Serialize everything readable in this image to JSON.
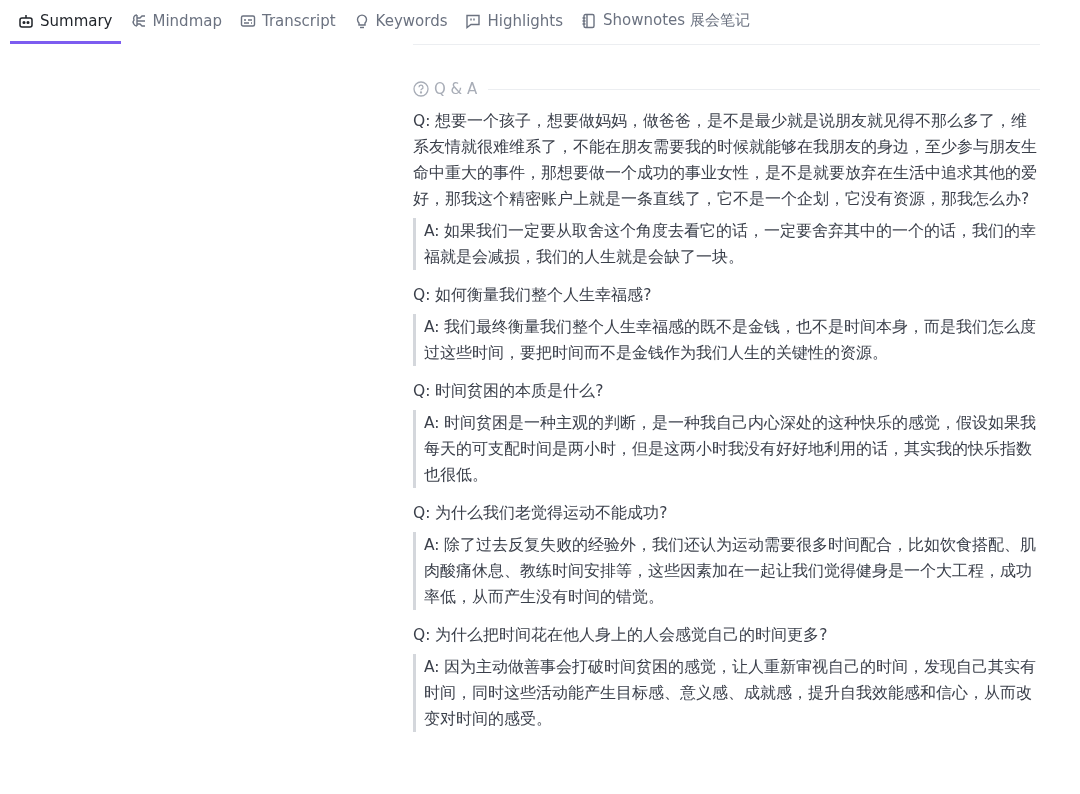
{
  "tabs": [
    {
      "label": "Summary",
      "selected": true
    },
    {
      "label": "Mindmap",
      "selected": false
    },
    {
      "label": "Transcript",
      "selected": false
    },
    {
      "label": "Keywords",
      "selected": false
    },
    {
      "label": "Highlights",
      "selected": false
    },
    {
      "label": "Shownotes 展会笔记",
      "selected": false
    }
  ],
  "section": {
    "title": "Q & A"
  },
  "qa": [
    {
      "question": "Q: 想要一个孩子，想要做妈妈，做爸爸，是不是最少就是说朋友就见得不那么多了，维系友情就很难维系了，不能在朋友需要我的时候就能够在我朋友的身边，至少参与朋友生命中重大的事件，那想要做一个成功的事业女性，是不是就要放弃在生活中追求其他的爱好，那我这个精密账户上就是一条直线了，它不是一个企划，它没有资源，那我怎么办?",
      "answer": "A: 如果我们一定要从取舍这个角度去看它的话，一定要舍弃其中的一个的话，我们的幸福就是会减损，我们的人生就是会缺了一块。"
    },
    {
      "question": "Q: 如何衡量我们整个人生幸福感?",
      "answer": "A: 我们最终衡量我们整个人生幸福感的既不是金钱，也不是时间本身，而是我们怎么度过这些时间，要把时间而不是金钱作为我们人生的关键性的资源。"
    },
    {
      "question": "Q: 时间贫困的本质是什么?",
      "answer": "A: 时间贫困是一种主观的判断，是一种我自己内心深处的这种快乐的感觉，假设如果我每天的可支配时间是两小时，但是这两小时我没有好好地利用的话，其实我的快乐指数也很低。"
    },
    {
      "question": "Q: 为什么我们老觉得运动不能成功?",
      "answer": "A: 除了过去反复失败的经验外，我们还认为运动需要很多时间配合，比如饮食搭配、肌肉酸痛休息、教练时间安排等，这些因素加在一起让我们觉得健身是一个大工程，成功率低，从而产生没有时间的错觉。"
    },
    {
      "question": "Q: 为什么把时间花在他人身上的人会感觉自己的时间更多?",
      "answer": "A: 因为主动做善事会打破时间贫困的感觉，让人重新审视自己的时间，发现自己其实有时间，同时这些活动能产生目标感、意义感、成就感，提升自我效能感和信心，从而改变对时间的感受。"
    }
  ]
}
